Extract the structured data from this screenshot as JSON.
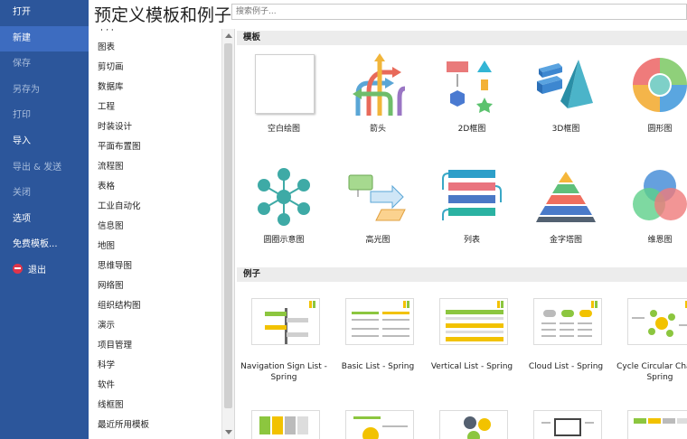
{
  "nav": {
    "items": [
      {
        "label": "打开",
        "state": "normal"
      },
      {
        "label": "新建",
        "state": "active"
      },
      {
        "label": "保存",
        "state": "dim"
      },
      {
        "label": "另存为",
        "state": "dim"
      },
      {
        "label": "打印",
        "state": "dim"
      },
      {
        "label": "导入",
        "state": "normal"
      },
      {
        "label": "导出 & 发送",
        "state": "dim"
      },
      {
        "label": "关闭",
        "state": "dim"
      },
      {
        "label": "选项",
        "state": "normal"
      },
      {
        "label": "免费模板...",
        "state": "normal"
      },
      {
        "label": "退出",
        "state": "normal"
      }
    ]
  },
  "header": {
    "title": "预定义模板和例子",
    "search_placeholder": "搜索例子..."
  },
  "categories": [
    "卡片",
    "图表",
    "剪切画",
    "数据库",
    "工程",
    "时装设计",
    "平面布置图",
    "流程图",
    "表格",
    "工业自动化",
    "信息图",
    "地图",
    "思维导图",
    "网络图",
    "组织结构图",
    "演示",
    "项目管理",
    "科学",
    "软件",
    "线框图",
    "最近所用模板"
  ],
  "templates": {
    "heading": "模板",
    "items": [
      {
        "label": "空白绘图",
        "icon": "blank-page-icon"
      },
      {
        "label": "箭头",
        "icon": "arrows-icon"
      },
      {
        "label": "2D框图",
        "icon": "2d-blocks-icon"
      },
      {
        "label": "3D框图",
        "icon": "3d-blocks-icon"
      },
      {
        "label": "圆形图",
        "icon": "circle-chart-icon"
      },
      {
        "label": "圆圈示意图",
        "icon": "circle-spoke-icon"
      },
      {
        "label": "高光图",
        "icon": "highlight-icon"
      },
      {
        "label": "列表",
        "icon": "list-icon"
      },
      {
        "label": "金字塔图",
        "icon": "pyramid-icon"
      },
      {
        "label": "维恩图",
        "icon": "venn-icon"
      }
    ]
  },
  "examples": {
    "heading": "例子",
    "items": [
      {
        "label": "Navigation Sign List - Spring"
      },
      {
        "label": "Basic List - Spring"
      },
      {
        "label": "Vertical List - Spring"
      },
      {
        "label": "Cloud List - Spring"
      },
      {
        "label": "Cycle Circular Chart - Spring"
      }
    ]
  },
  "colors": {
    "nav_bg": "#2c569b",
    "nav_active": "#3d6cc0",
    "accent_green": "#8cc63f",
    "accent_yellow": "#f2c200"
  }
}
